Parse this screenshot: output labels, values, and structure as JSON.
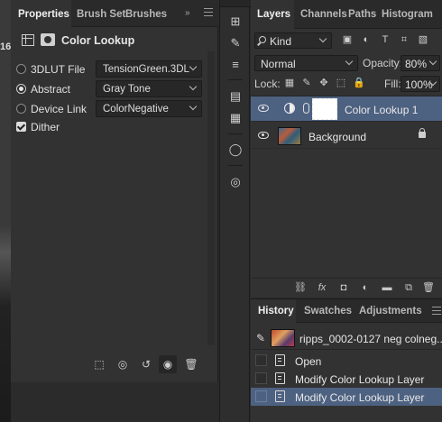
{
  "canvas": {
    "ruler_number": "16"
  },
  "properties": {
    "tabs": [
      "Properties",
      "Brush Set",
      "Brushes"
    ],
    "collapse_glyph": "»",
    "title": "Color Lookup",
    "header_icons": [
      "adjustment-grid-icon",
      "layer-mask-icon"
    ],
    "options": [
      {
        "label": "3DLUT File",
        "value": "TensionGreen.3DL",
        "selected": false
      },
      {
        "label": "Abstract",
        "value": "Gray Tone",
        "selected": true
      },
      {
        "label": "Device Link",
        "value": "ColorNegative",
        "selected": false
      }
    ],
    "dither": {
      "label": "Dither",
      "checked": true
    },
    "footer_icons": [
      "clip-to-layer-icon",
      "view-previous-state-icon",
      "reset-icon",
      "visibility-icon",
      "trash-icon"
    ],
    "footer_glyphs": {
      "clip": "⬚",
      "prev": "◎",
      "reset": "↺",
      "eye": "◉",
      "trash": "🗑"
    }
  },
  "tools": {
    "icons": [
      "history-brush-tool-icon",
      "brush-settings-icon",
      "adjust-sliders-icon",
      "properties-doc-icon",
      "notes-icon",
      "lightbulb-icon",
      "creative-cloud-icon"
    ],
    "glyphs": {
      "a": "⊞",
      "b": "✎",
      "c": "≡",
      "d": "▤",
      "e": "▦",
      "f": "◯",
      "g": "◎"
    }
  },
  "layers": {
    "tabs": [
      "Layers",
      "Channels",
      "Paths",
      "Histogram"
    ],
    "filter": {
      "kind": "Kind",
      "icons": [
        "image-filter-icon",
        "adjustment-filter-icon",
        "type-filter-icon",
        "shape-filter-icon",
        "smart-object-filter-icon"
      ],
      "glyphs": [
        "▣",
        "◐",
        "T",
        "⌗",
        "▧"
      ]
    },
    "blend_mode": "Normal",
    "opacity_label": "Opacity:",
    "opacity": "80%",
    "lock_label": "Lock:",
    "lock_glyphs": [
      "▦",
      "✎",
      "✥",
      "⬚",
      "🔒"
    ],
    "fill_label": "Fill:",
    "fill": "100%",
    "items": [
      {
        "name": "Color Lookup 1",
        "selected": true,
        "visible": true
      },
      {
        "name": "Background",
        "selected": false,
        "visible": true,
        "locked": true
      }
    ],
    "footer_glyphs": [
      "⛓",
      "fx",
      "◘",
      "◐",
      "▬",
      "⧉",
      "🗑"
    ],
    "footer_icons": [
      "link-layers-icon",
      "fx-icon",
      "add-mask-icon",
      "new-adjustment-icon",
      "new-group-icon",
      "new-layer-icon",
      "delete-layer-icon"
    ]
  },
  "history": {
    "tabs": [
      "History",
      "Swatches",
      "Adjustments"
    ],
    "snapshot_name": "ripps_0002-0127 neg colneg...",
    "states": [
      {
        "label": "Open",
        "selected": false
      },
      {
        "label": "Modify Color Lookup Layer",
        "selected": false
      },
      {
        "label": "Modify Color Lookup Layer",
        "selected": true
      }
    ]
  },
  "colors": {
    "panel_bg": "#323232",
    "tab_bg": "#2a2a2a",
    "selection": "#4d6181"
  }
}
